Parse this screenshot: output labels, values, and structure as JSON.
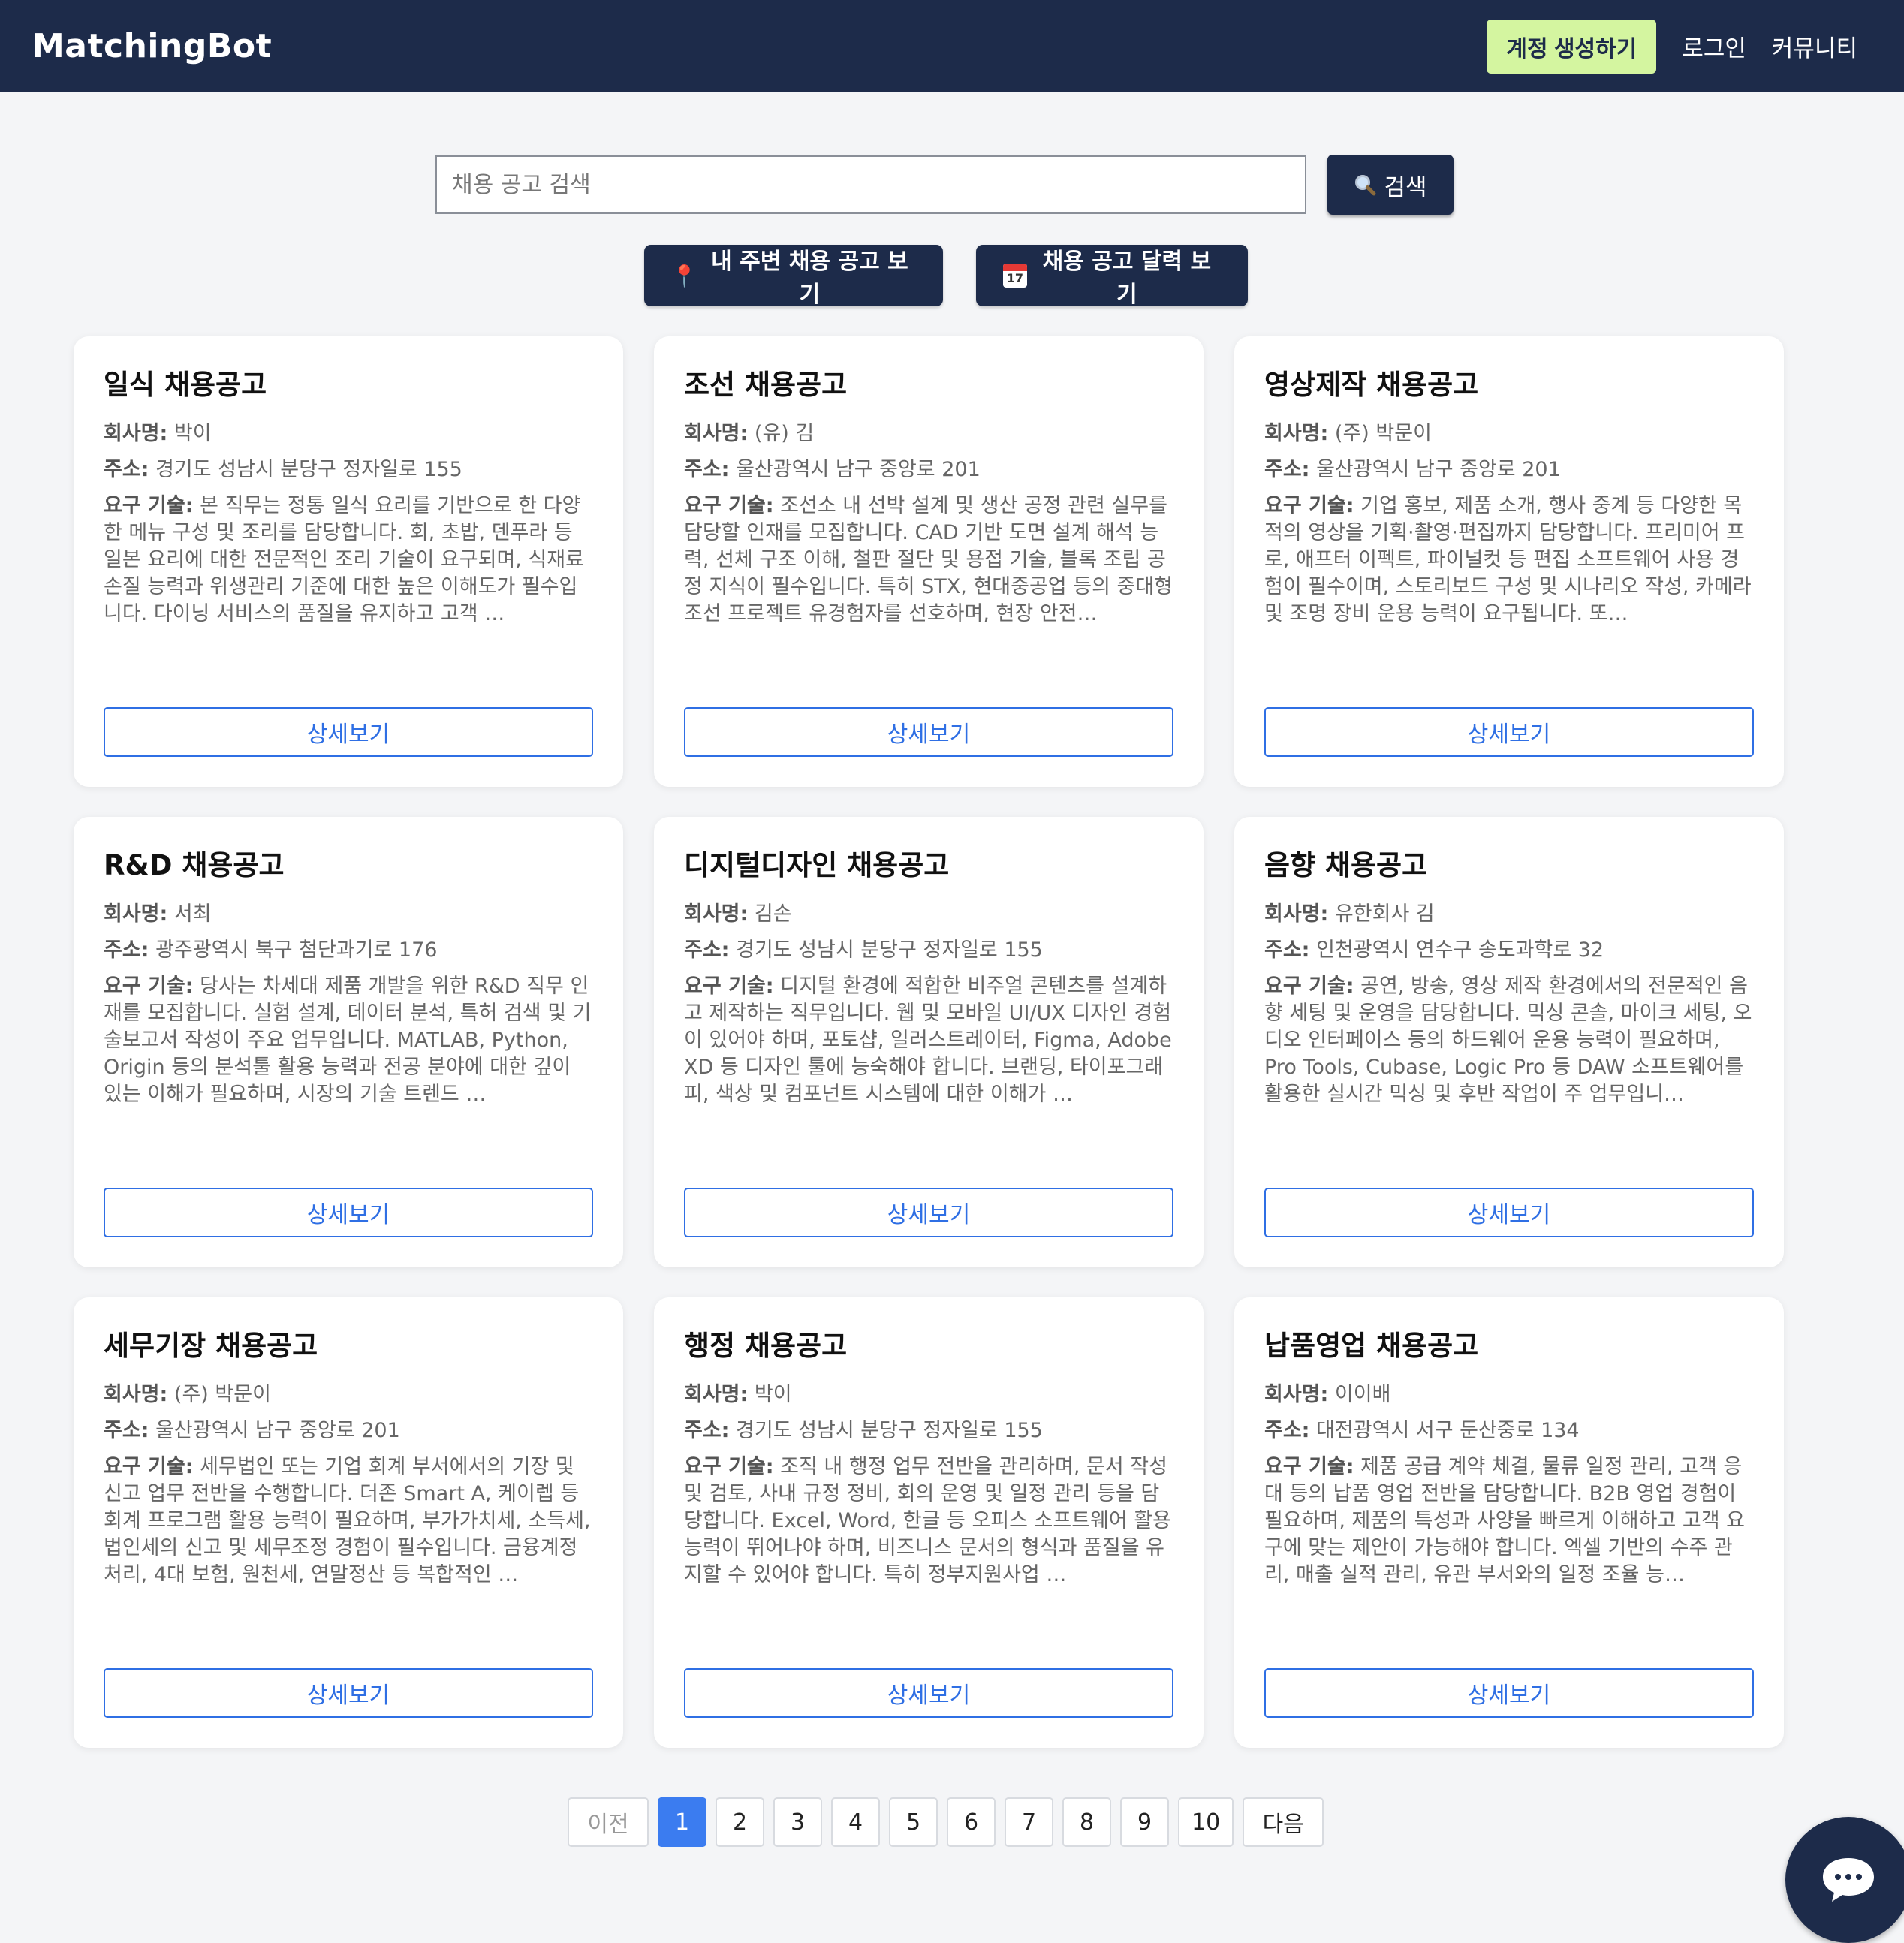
{
  "header": {
    "brand": "MatchingBot",
    "signup_label": "계정 생성하기",
    "login_label": "로그인",
    "community_label": "커뮤니티"
  },
  "search": {
    "placeholder": "채용 공고 검색",
    "button_label": "검색",
    "button_icon": "magnifier-icon"
  },
  "quick_actions": {
    "nearby_label": "내 주변 채용 공고 보기",
    "calendar_label": "채용 공고 달력 보기",
    "calendar_icon_day": "17"
  },
  "labels": {
    "company": "회사명:",
    "address": "주소:",
    "skills": "요구 기술:",
    "detail": "상세보기"
  },
  "jobs": [
    {
      "title": "일식 채용공고",
      "company": "박이",
      "address": "경기도 성남시 분당구 정자일로 155",
      "skills": "본 직무는 정통 일식 요리를 기반으로 한 다양한 메뉴 구성 및 조리를 담당합니다. 회, 초밥, 덴푸라 등 일본 요리에 대한 전문적인 조리 기술이 요구되며, 식재료 손질 능력과 위생관리 기준에 대한 높은 이해도가 필수입니다. 다이닝 서비스의 품질을 유지하고 고객 …"
    },
    {
      "title": "조선 채용공고",
      "company": "(유) 김",
      "address": "울산광역시 남구 중앙로 201",
      "skills": "조선소 내 선박 설계 및 생산 공정 관련 실무를 담당할 인재를 모집합니다. CAD 기반 도면 설계 해석 능력, 선체 구조 이해, 철판 절단 및 용접 기술, 블록 조립 공정 지식이 필수입니다. 특히 STX, 현대중공업 등의 중대형 조선 프로젝트 유경험자를 선호하며, 현장 안전…"
    },
    {
      "title": "영상제작 채용공고",
      "company": "(주) 박문이",
      "address": "울산광역시 남구 중앙로 201",
      "skills": "기업 홍보, 제품 소개, 행사 중계 등 다양한 목적의 영상을 기획·촬영·편집까지 담당합니다. 프리미어 프로, 애프터 이펙트, 파이널컷 등 편집 소프트웨어 사용 경험이 필수이며, 스토리보드 구성 및 시나리오 작성, 카메라 및 조명 장비 운용 능력이 요구됩니다. 또…"
    },
    {
      "title": "R&D 채용공고",
      "company": "서최",
      "address": "광주광역시 북구 첨단과기로 176",
      "skills": "당사는 차세대 제품 개발을 위한 R&D 직무 인재를 모집합니다. 실험 설계, 데이터 분석, 특허 검색 및 기술보고서 작성이 주요 업무입니다. MATLAB, Python, Origin 등의 분석툴 활용 능력과 전공 분야에 대한 깊이 있는 이해가 필요하며, 시장의 기술 트렌드 …"
    },
    {
      "title": "디지털디자인 채용공고",
      "company": "김손",
      "address": "경기도 성남시 분당구 정자일로 155",
      "skills": "디지털 환경에 적합한 비주얼 콘텐츠를 설계하고 제작하는 직무입니다. 웹 및 모바일 UI/UX 디자인 경험이 있어야 하며, 포토샵, 일러스트레이터, Figma, Adobe XD 등 디자인 툴에 능숙해야 합니다. 브랜딩, 타이포그래피, 색상 및 컴포넌트 시스템에 대한 이해가 …"
    },
    {
      "title": "음향 채용공고",
      "company": "유한회사 김",
      "address": "인천광역시 연수구 송도과학로 32",
      "skills": "공연, 방송, 영상 제작 환경에서의 전문적인 음향 세팅 및 운영을 담당합니다. 믹싱 콘솔, 마이크 세팅, 오디오 인터페이스 등의 하드웨어 운용 능력이 필요하며, Pro Tools, Cubase, Logic Pro 등 DAW 소프트웨어를 활용한 실시간 믹싱 및 후반 작업이 주 업무입니…"
    },
    {
      "title": "세무기장 채용공고",
      "company": "(주) 박문이",
      "address": "울산광역시 남구 중앙로 201",
      "skills": "세무법인 또는 기업 회계 부서에서의 기장 및 신고 업무 전반을 수행합니다. 더존 Smart A, 케이렙 등 회계 프로그램 활용 능력이 필요하며, 부가가치세, 소득세, 법인세의 신고 및 세무조정 경험이 필수입니다. 금융계정 처리, 4대 보험, 원천세, 연말정산 등 복합적인 …"
    },
    {
      "title": "행정 채용공고",
      "company": "박이",
      "address": "경기도 성남시 분당구 정자일로 155",
      "skills": "조직 내 행정 업무 전반을 관리하며, 문서 작성 및 검토, 사내 규정 정비, 회의 운영 및 일정 관리 등을 담당합니다. Excel, Word, 한글 등 오피스 소프트웨어 활용 능력이 뛰어나야 하며, 비즈니스 문서의 형식과 품질을 유지할 수 있어야 합니다. 특히 정부지원사업 …"
    },
    {
      "title": "납품영업 채용공고",
      "company": "이이배",
      "address": "대전광역시 서구 둔산중로 134",
      "skills": "제품 공급 계약 체결, 물류 일정 관리, 고객 응대 등의 납품 영업 전반을 담당합니다. B2B 영업 경험이 필요하며, 제품의 특성과 사양을 빠르게 이해하고 고객 요구에 맞는 제안이 가능해야 합니다. 엑셀 기반의 수주 관리, 매출 실적 관리, 유관 부서와의 일정 조율 능…"
    }
  ],
  "pagination": {
    "prev_label": "이전",
    "next_label": "다음",
    "pages": [
      "1",
      "2",
      "3",
      "4",
      "5",
      "6",
      "7",
      "8",
      "9",
      "10"
    ],
    "current": "1"
  },
  "chat": {
    "icon": "chat-bubble-icon"
  },
  "colors": {
    "header_bg": "#1d2b4a",
    "signup_bg": "#d4f5a0",
    "accent_blue": "#2f6fe4",
    "page_active": "#3b7cf0"
  }
}
